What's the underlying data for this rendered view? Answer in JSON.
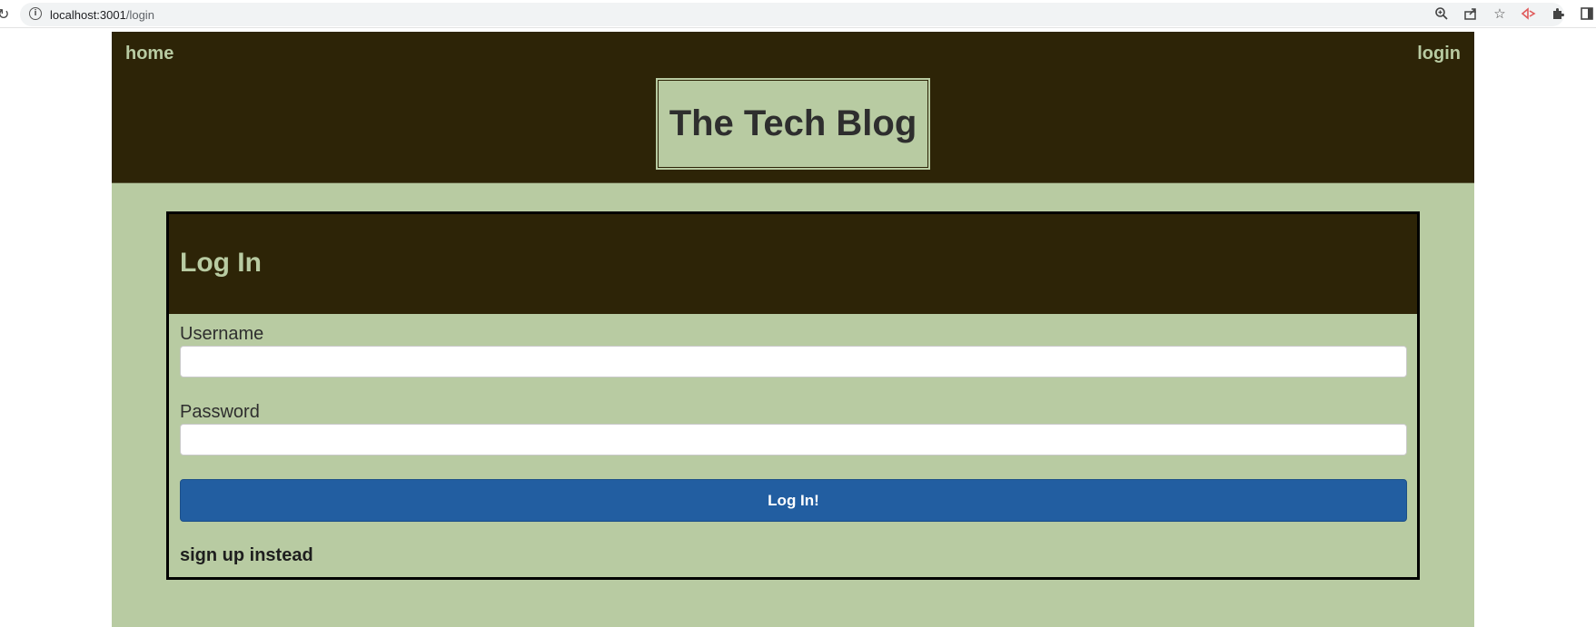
{
  "browser": {
    "url_host": "localhost:3001",
    "url_path": "/login",
    "icons": [
      "reload-icon",
      "info-icon",
      "zoom-icon",
      "share-icon",
      "star-icon",
      "extension-icon",
      "puzzle-icon",
      "sidepanel-icon"
    ]
  },
  "nav": {
    "home_label": "home",
    "login_label": "login"
  },
  "header": {
    "title": "The Tech Blog"
  },
  "login_card": {
    "heading": "Log In",
    "username_label": "Username",
    "username_value": "",
    "password_label": "Password",
    "password_value": "",
    "submit_label": "Log In!",
    "signup_link": "sign up instead"
  },
  "colors": {
    "dark": "#2d2407",
    "sage": "#b8cba2",
    "button_blue": "#225ea1"
  }
}
